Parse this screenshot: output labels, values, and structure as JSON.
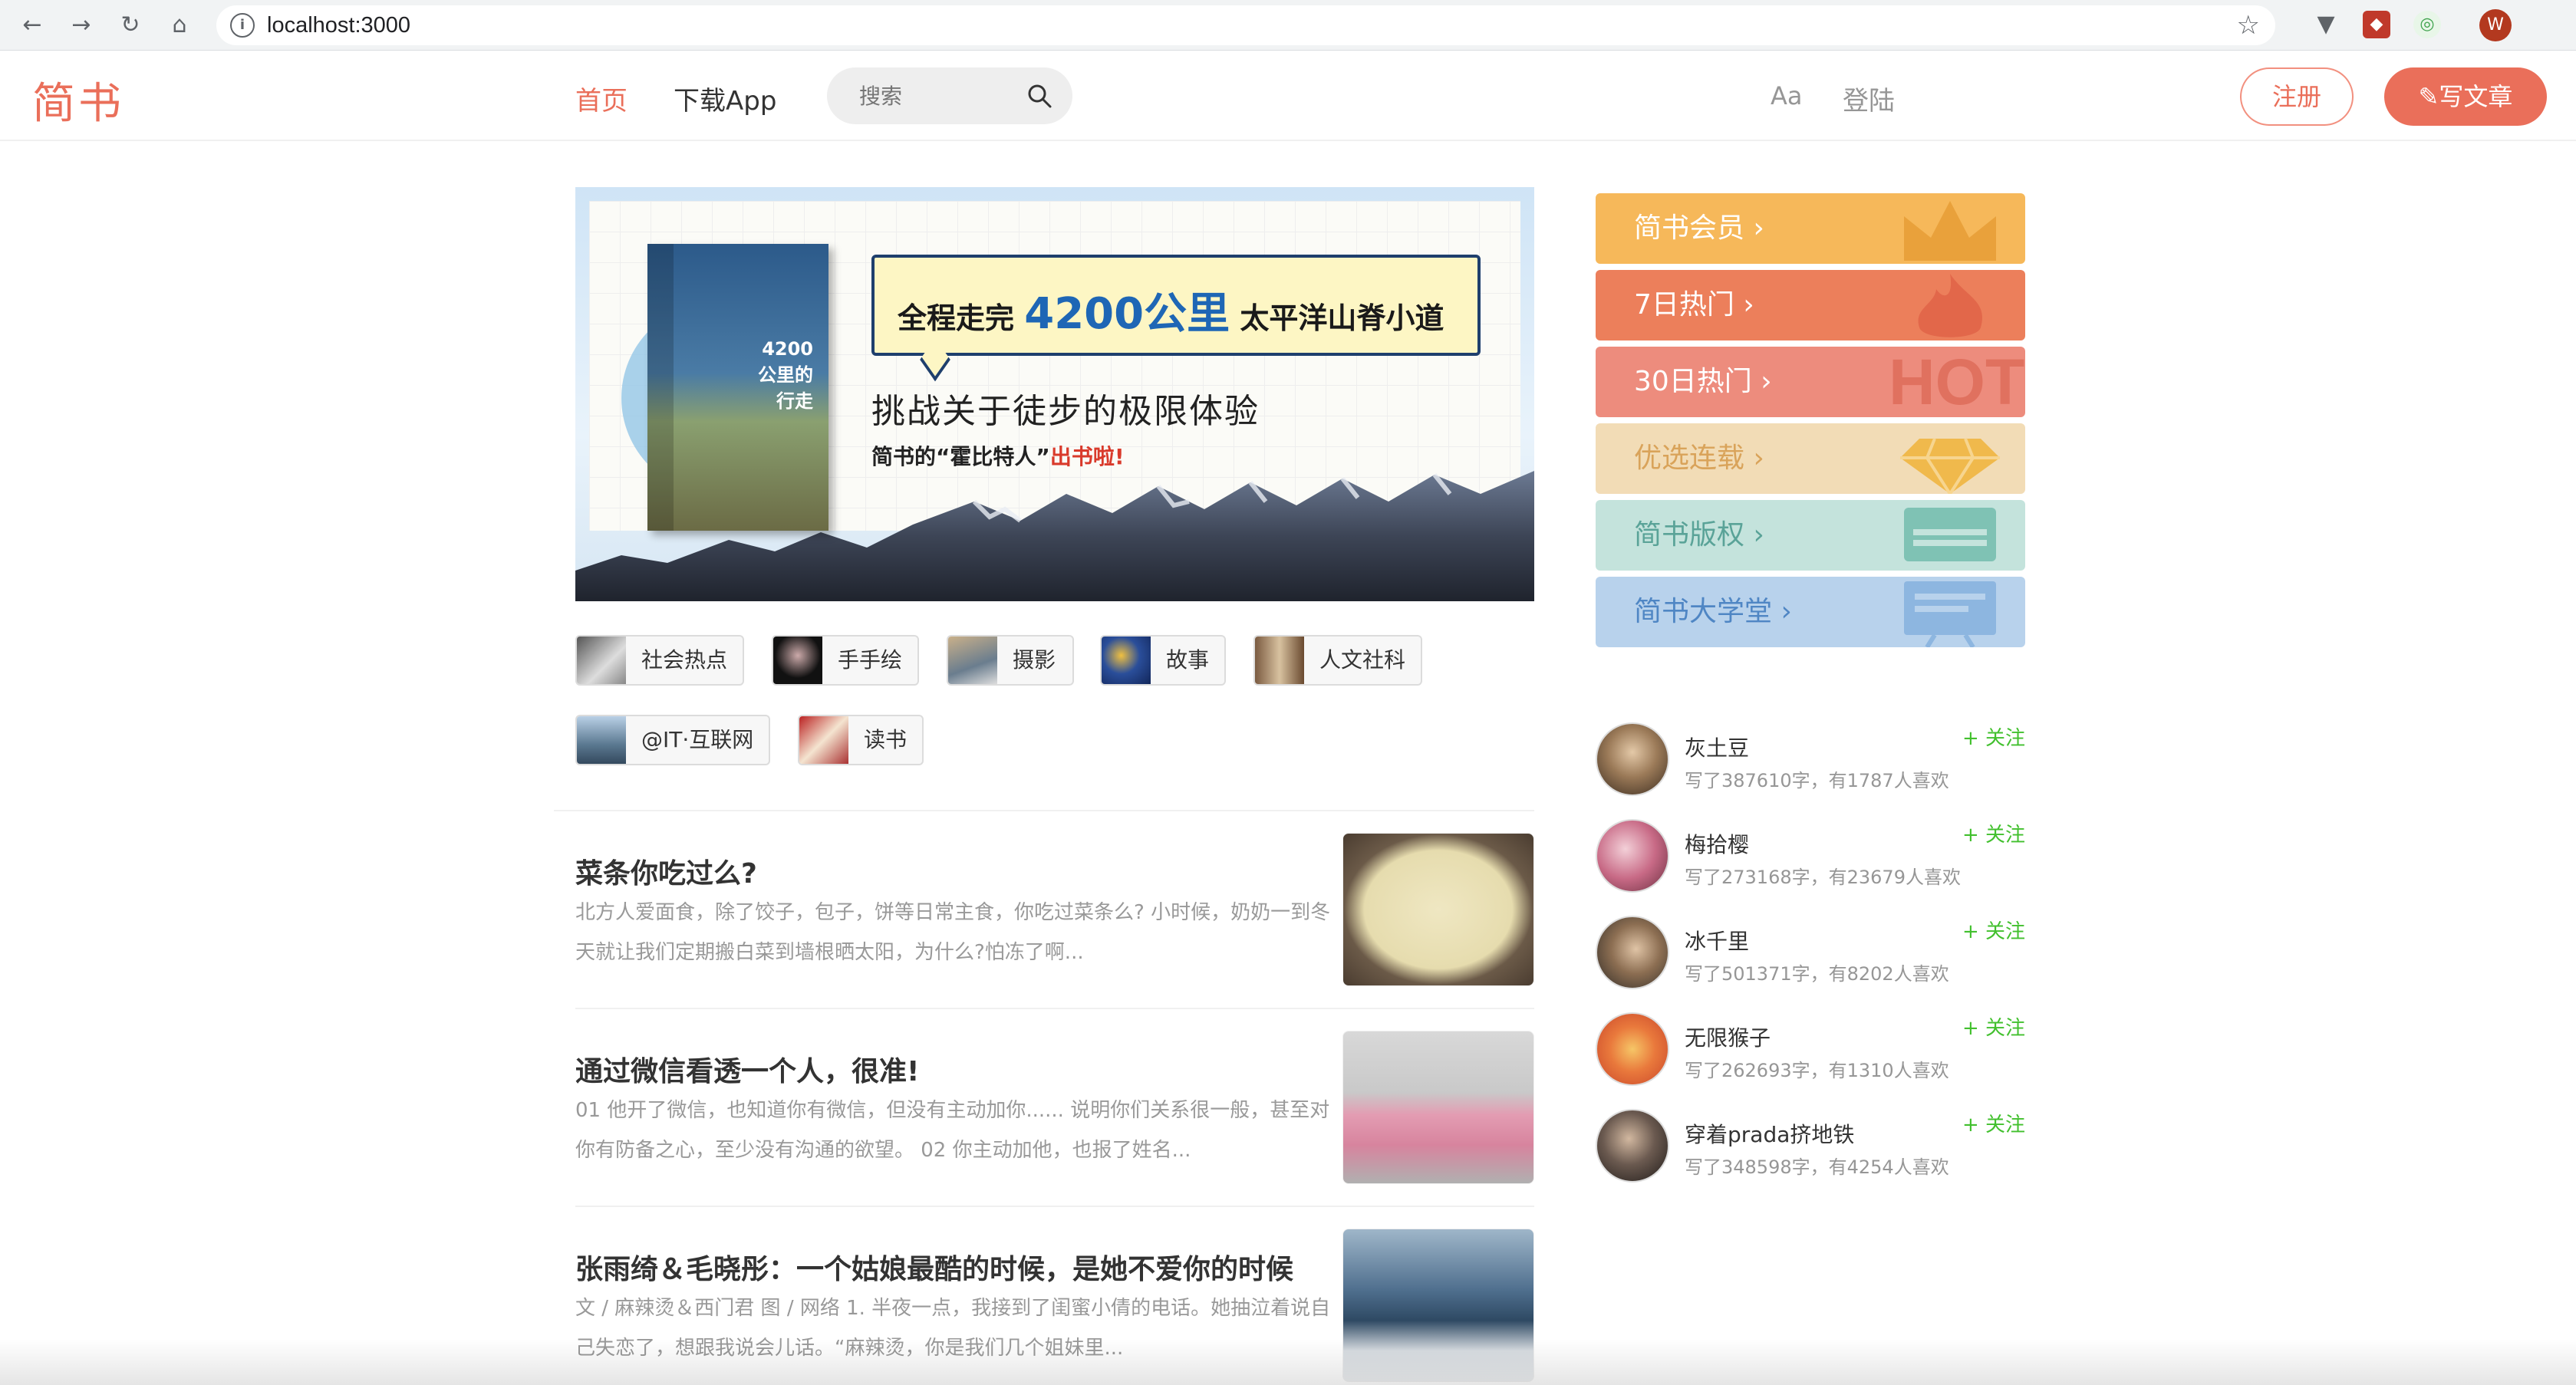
{
  "browser": {
    "url": "localhost:3000",
    "profile_initial": "W"
  },
  "header": {
    "logo": "简书",
    "nav_home": "首页",
    "nav_app": "下载App",
    "search_placeholder": "搜索",
    "font_toggle": "Aa",
    "login": "登陆",
    "register": "注册",
    "write": "写文章"
  },
  "banner": {
    "bubble_pre": "全程走完",
    "bubble_big": "4200公里",
    "bubble_post": "太平洋山脊小道",
    "subtitle": "挑战关于徒步的极限体验",
    "tagline": "简书的“霍比特人”",
    "tagline_red": "出书啦!",
    "book_title": "4200\n公里的\n行走"
  },
  "topics": [
    {
      "name": "社会热点"
    },
    {
      "name": "手手绘"
    },
    {
      "name": "摄影"
    },
    {
      "name": "故事"
    },
    {
      "name": "人文社科"
    },
    {
      "name": "@IT·互联网"
    },
    {
      "name": "读书"
    }
  ],
  "articles": [
    {
      "title": "菜条你吃过么?",
      "summary": "北方人爱面食，除了饺子，包子，饼等日常主食，你吃过菜条么? 小时候，奶奶一到冬天就让我们定期搬白菜到墙根晒太阳，为什么?怕冻了啊..."
    },
    {
      "title": "通过微信看透一个人，很准!",
      "summary": "01 他开了微信，也知道你有微信，但没有主动加你...... 说明你们关系很一般，甚至对你有防备之心，至少没有沟通的欲望。 02 你主动加他，也报了姓名..."
    },
    {
      "title": "张雨绮＆毛晓彤：一个姑娘最酷的时候，是她不爱你的时候",
      "summary": "文 / 麻辣烫＆西门君 图 / 网络 1. 半夜一点，我接到了闺蜜小倩的电话。她抽泣着说自己失恋了，想跟我说会儿话。“麻辣烫，你是我们几个姐妹里..."
    }
  ],
  "board": [
    {
      "label": "简书会员 ›",
      "color": "#f6b85a",
      "deco": "crown"
    },
    {
      "label": "7日热门 ›",
      "color": "#ec7f5b",
      "deco": "flame"
    },
    {
      "label": "30日热门 ›",
      "color": "#ed8c7d",
      "deco": "hot"
    },
    {
      "label": "优选连载 ›",
      "color": "#f2dcb6",
      "deco": "diamond"
    },
    {
      "label": "简书版权 ›",
      "color": "#c4e3dc",
      "deco": "typewriter"
    },
    {
      "label": "简书大学堂 ›",
      "color": "#b8d2ec",
      "deco": "board"
    }
  ],
  "board_hot_text": "HOT",
  "authors": [
    {
      "name": "灰土豆",
      "info": "写了387610字，有1787人喜欢",
      "follow": "+ 关注"
    },
    {
      "name": "梅拾樱",
      "info": "写了273168字，有23679人喜欢",
      "follow": "+ 关注"
    },
    {
      "name": "冰千里",
      "info": "写了501371字，有8202人喜欢",
      "follow": "+ 关注"
    },
    {
      "name": "无限猴子",
      "info": "写了262693字，有1310人喜欢",
      "follow": "+ 关注"
    },
    {
      "name": "穿着prada挤地铁",
      "info": "写了348598字，有4254人喜欢",
      "follow": "+ 关注"
    }
  ],
  "colors": {
    "brand": "#ea6f5a",
    "follow_green": "#42c02e"
  }
}
